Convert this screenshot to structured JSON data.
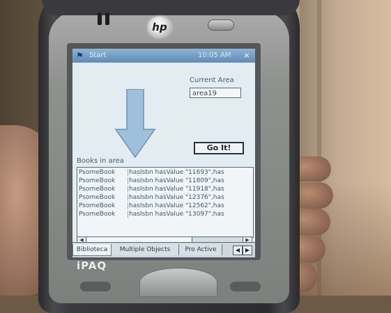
{
  "device": {
    "brand_logo": "hp",
    "model_label": "iPAQ"
  },
  "titlebar": {
    "start_label": "Start",
    "time_label": "10:05 AM",
    "close_symbol": "×"
  },
  "form": {
    "current_area_label": "Current Area",
    "current_area_value": "area19",
    "go_button_label": "Go It!",
    "books_label": "Books in area",
    "books": [
      {
        "subject": "PsomeBook",
        "statement": "hasIsbn hasValue \"11693\",has"
      },
      {
        "subject": "PsomeBook",
        "statement": "hasIsbn hasValue \"11809\",has"
      },
      {
        "subject": "PsomeBook",
        "statement": "hasIsbn hasValue \"11918\",has"
      },
      {
        "subject": "PsomeBook",
        "statement": "hasIsbn hasValue \"12376\",has"
      },
      {
        "subject": "PsomeBook",
        "statement": "hasIsbn hasValue \"12562\",has"
      },
      {
        "subject": "PsomeBook",
        "statement": "hasIsbn hasValue \"13097\",has"
      }
    ]
  },
  "tabs": [
    {
      "label": "Biblioteca",
      "active": true
    },
    {
      "label": "Multiple Objects",
      "active": false
    },
    {
      "label": "Pro Active",
      "active": false
    }
  ],
  "colors": {
    "screen_background": "#e3ecf1",
    "titlebar": "#5f8bb8",
    "arrow_fill": "#9fc0dc"
  }
}
